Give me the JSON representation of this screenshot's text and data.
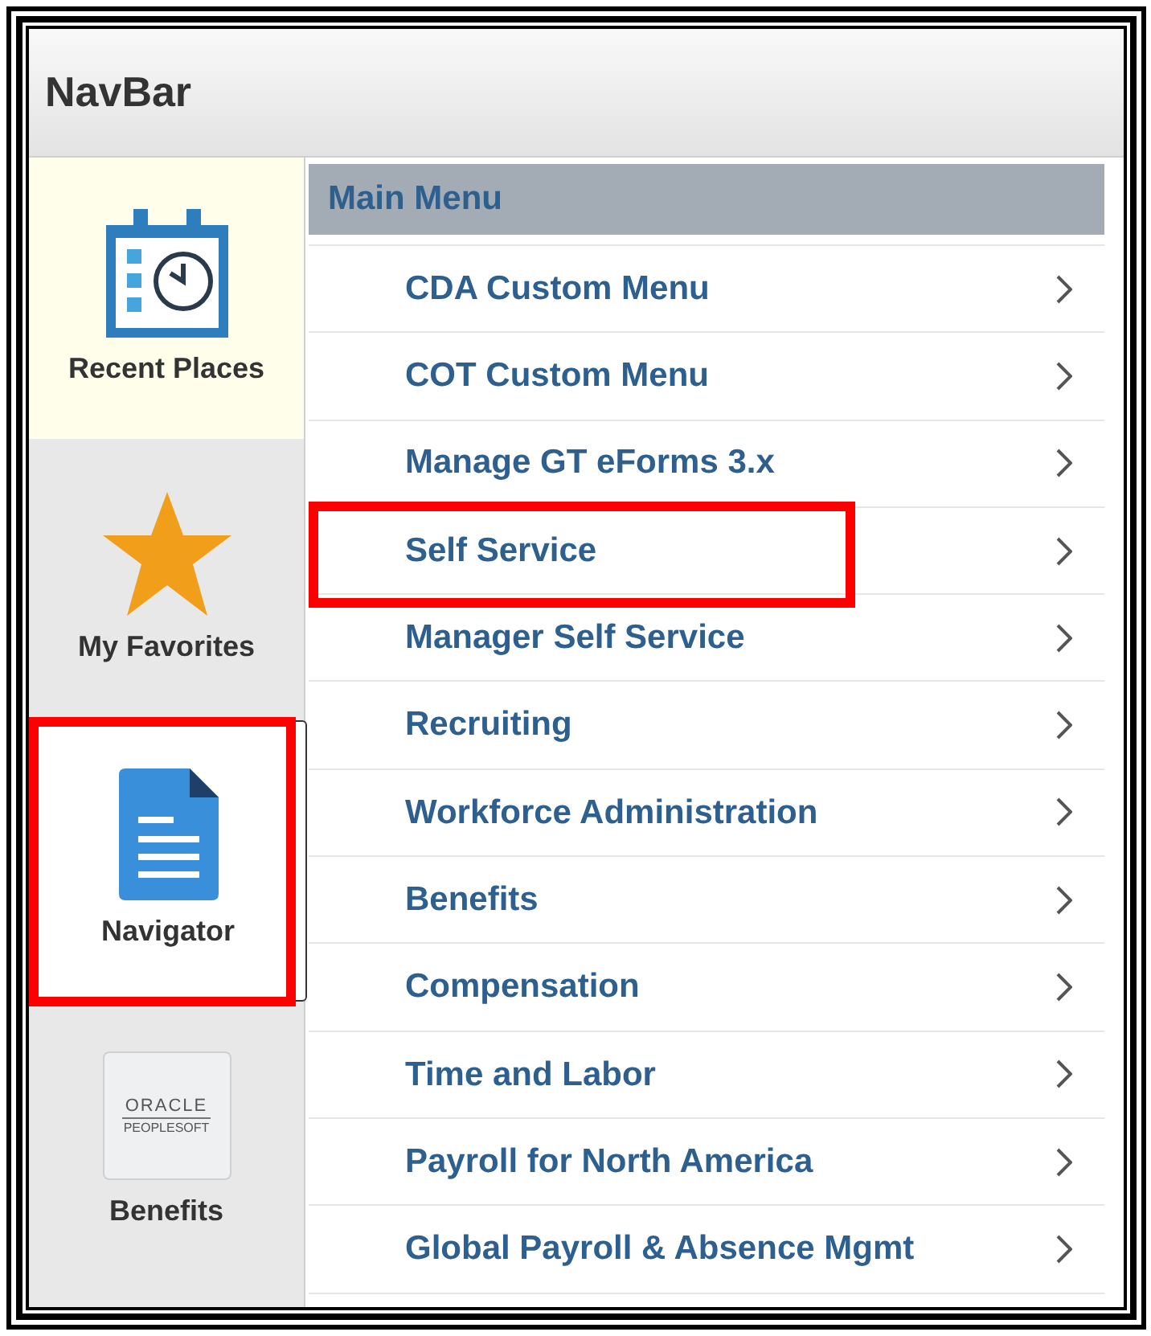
{
  "header": {
    "title": "NavBar"
  },
  "sidebar": {
    "items": [
      {
        "kind": "recent",
        "label": "Recent Places",
        "selected": false,
        "highlighted": false
      },
      {
        "kind": "favorites",
        "label": "My Favorites",
        "selected": false,
        "highlighted": false
      },
      {
        "kind": "navigator",
        "label": "Navigator",
        "selected": true,
        "highlighted": true
      },
      {
        "kind": "logo",
        "label": "Benefits",
        "logo_lines": [
          "ORACLE",
          "PEOPLESOFT"
        ],
        "selected": false,
        "highlighted": false
      }
    ]
  },
  "menu": {
    "title": "Main Menu",
    "items": [
      {
        "label": "CDA Custom Menu",
        "highlighted": false
      },
      {
        "label": "COT Custom Menu",
        "highlighted": false
      },
      {
        "label": "Manage GT eForms 3.x",
        "highlighted": false
      },
      {
        "label": "Self Service",
        "highlighted": true
      },
      {
        "label": "Manager Self Service",
        "highlighted": false
      },
      {
        "label": "Recruiting",
        "highlighted": false
      },
      {
        "label": "Workforce Administration",
        "highlighted": false
      },
      {
        "label": "Benefits",
        "highlighted": false
      },
      {
        "label": "Compensation",
        "highlighted": false
      },
      {
        "label": "Time and Labor",
        "highlighted": false
      },
      {
        "label": "Payroll for North America",
        "highlighted": false
      },
      {
        "label": "Global Payroll & Absence Mgmt",
        "highlighted": false
      }
    ]
  }
}
